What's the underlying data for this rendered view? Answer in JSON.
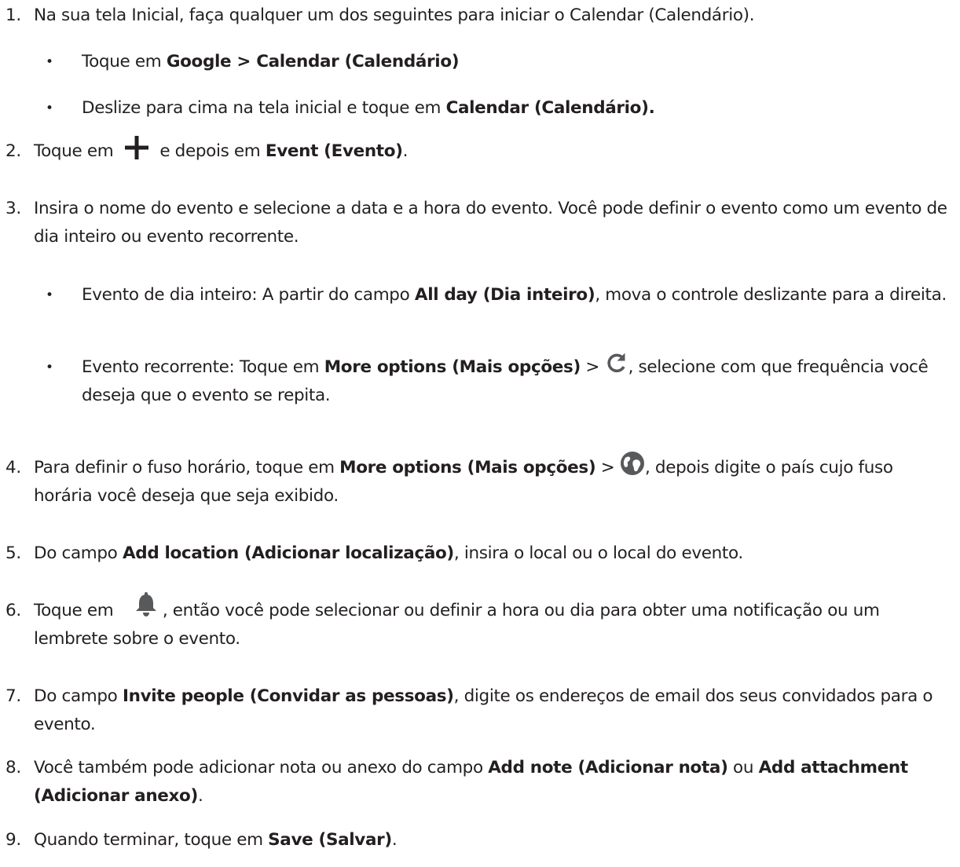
{
  "steps": {
    "s1": {
      "num": "1.",
      "text": "Na sua tela Inicial, faça qualquer um dos seguintes para iniciar o Calendar (Calendário)."
    },
    "b1": {
      "pre": "Toque em ",
      "bold": "Google > Calendar (Calendário)"
    },
    "b2": {
      "pre": "Deslize para cima na tela inicial e toque em ",
      "bold": "Calendar (Calendário)."
    },
    "s2": {
      "num": "2.",
      "pre": "Toque em",
      "mid": "e depois em ",
      "bold": "Event (Evento)",
      "post": "."
    },
    "s3": {
      "num": "3.",
      "text": "Insira o nome do evento e selecione a data e a hora do evento. Você pode definir o evento como um evento de dia inteiro ou evento recorrente."
    },
    "b3": {
      "pre": "Evento de dia inteiro: A partir do campo ",
      "bold": "All day (Dia inteiro)",
      "post": ", mova o controle deslizante para a direita."
    },
    "b4": {
      "pre": "Evento recorrente: Toque em ",
      "bold": "More options (Mais opções)",
      "gt": " > ",
      "post": ", selecione com que frequência você deseja que o evento se repita."
    },
    "s4": {
      "num": "4.",
      "pre": "Para definir o fuso horário, toque em ",
      "bold": "More options (Mais opções)",
      "gt": " > ",
      "post": ", depois digite o país cujo fuso horária você deseja que seja exibido."
    },
    "s5": {
      "num": "5.",
      "pre": "Do campo ",
      "bold": "Add location (Adicionar localização)",
      "post": ", insira o local ou o local do evento."
    },
    "s6": {
      "num": "6.",
      "pre": "Toque em",
      "post": ", então você pode selecionar ou definir a hora ou dia para obter uma notificação ou um lembrete sobre o evento."
    },
    "s7": {
      "num": "7.",
      "pre": "Do campo ",
      "bold": "Invite people (Convidar as pessoas)",
      "post": ", digite os endereços de email dos seus convidados para o evento."
    },
    "s8": {
      "num": "8.",
      "pre": "Você também pode adicionar nota ou anexo do campo ",
      "bold": "Add note (Adicionar nota)",
      "mid": " ou ",
      "bold2": "Add attachment (Adicionar anexo)",
      "post": "."
    },
    "s9": {
      "num": "9.",
      "pre": "Quando terminar, toque em ",
      "bold": "Save (Salvar)",
      "post": "."
    }
  },
  "bullet_char": "•",
  "icons": [
    "plus-icon",
    "refresh-icon",
    "globe-icon",
    "bell-icon"
  ],
  "colors": {
    "text": "#231f20",
    "icon": "#58595b"
  }
}
